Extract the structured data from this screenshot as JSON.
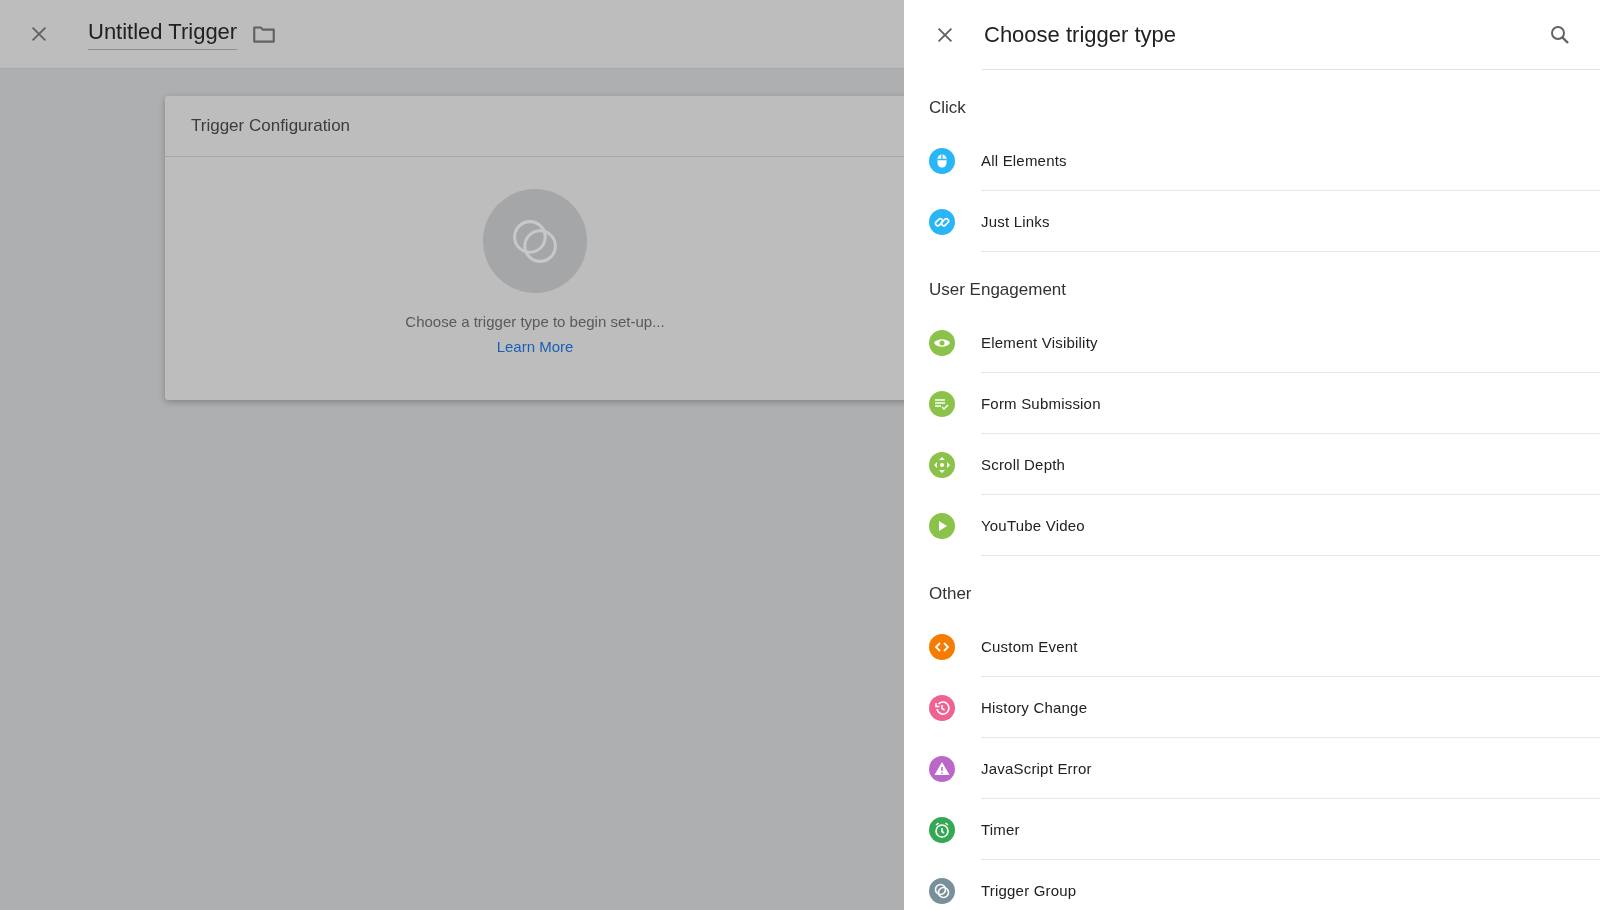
{
  "editor": {
    "title": "Untitled Trigger"
  },
  "card": {
    "title": "Trigger Configuration",
    "message": "Choose a trigger type to begin set-up...",
    "link": "Learn More"
  },
  "panel": {
    "title": "Choose trigger type"
  },
  "sections": [
    {
      "label": "Click",
      "items": [
        {
          "label": "All Elements",
          "kind": "mouse",
          "color": "#29b6f6"
        },
        {
          "label": "Just Links",
          "kind": "link",
          "color": "#29b6f6"
        }
      ]
    },
    {
      "label": "User Engagement",
      "items": [
        {
          "label": "Element Visibility",
          "kind": "eye",
          "color": "#8bc34a"
        },
        {
          "label": "Form Submission",
          "kind": "form",
          "color": "#8bc34a"
        },
        {
          "label": "Scroll Depth",
          "kind": "move",
          "color": "#8bc34a"
        },
        {
          "label": "YouTube Video",
          "kind": "play",
          "color": "#8bc34a"
        }
      ]
    },
    {
      "label": "Other",
      "items": [
        {
          "label": "Custom Event",
          "kind": "code",
          "color": "#f57c00"
        },
        {
          "label": "History Change",
          "kind": "history",
          "color": "#f06292"
        },
        {
          "label": "JavaScript Error",
          "kind": "warning",
          "color": "#ba68c8"
        },
        {
          "label": "Timer",
          "kind": "alarm",
          "color": "#34a853"
        },
        {
          "label": "Trigger Group",
          "kind": "group",
          "color": "#78909c"
        }
      ]
    }
  ]
}
